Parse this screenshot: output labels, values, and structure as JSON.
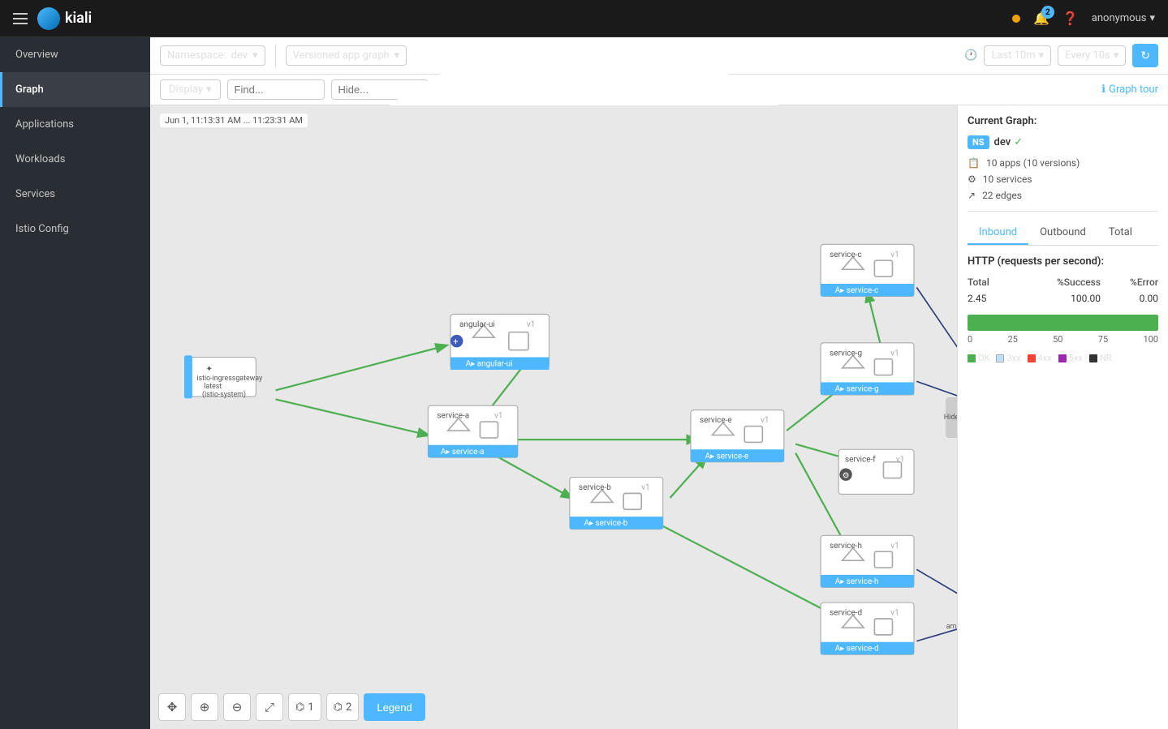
{
  "navbar": {
    "hamburger_label": "Menu",
    "brand_name": "kiali",
    "notifications_count": "2",
    "help_icon": "?",
    "user_name": "anonymous",
    "user_dot_color": "#f0a000"
  },
  "sidebar": {
    "items": [
      {
        "id": "overview",
        "label": "Overview",
        "active": false
      },
      {
        "id": "graph",
        "label": "Graph",
        "active": true
      },
      {
        "id": "applications",
        "label": "Applications",
        "active": false
      },
      {
        "id": "workloads",
        "label": "Workloads",
        "active": false
      },
      {
        "id": "services",
        "label": "Services",
        "active": false
      },
      {
        "id": "istio-config",
        "label": "Istio Config",
        "active": false
      }
    ]
  },
  "toolbar": {
    "namespace_label": "Namespace:",
    "namespace_value": "dev",
    "graph_type_label": "Versioned app graph",
    "display_label": "Display",
    "find_placeholder": "Find...",
    "hide_placeholder": "Hide...",
    "time_range_label": "Last 10m",
    "refresh_interval_label": "Every 10s",
    "graph_tour_label": "Graph tour",
    "refresh_icon": "↻"
  },
  "graph": {
    "timestamp": "Jun 1, 11:13:31 AM ... 11:23:31 AM"
  },
  "bottom_controls": {
    "btn_move": "✥",
    "btn_zoom_in": "⊕",
    "btn_zoom_out": "⊖",
    "btn_fit": "⤢",
    "btn_layout1": "⌬",
    "btn_count1": "1",
    "btn_layout2": "⌬",
    "btn_count2": "2",
    "legend_label": "Legend"
  },
  "side_panel": {
    "title": "Current Graph:",
    "namespace_badge": "NS",
    "namespace_name": "dev",
    "namespace_check": "✓",
    "stats": {
      "apps": "10 apps (10 versions)",
      "services": "10 services",
      "edges": "22 edges"
    },
    "tabs": [
      "Inbound",
      "Outbound",
      "Total"
    ],
    "active_tab": "Inbound",
    "http_title": "HTTP (requests per second):",
    "table_headers": [
      "Total",
      "%Success",
      "%Error"
    ],
    "table_values": [
      "2.45",
      "100.00",
      "0.00"
    ],
    "progress_labels": [
      "0",
      "25",
      "50",
      "75",
      "100"
    ],
    "legend": [
      {
        "label": "OK",
        "color": "#4caf50"
      },
      {
        "label": "3xx",
        "color": "#c0e0ff"
      },
      {
        "label": "4xx",
        "color": "#f44336"
      },
      {
        "label": "5xx",
        "color": "#9c27b0"
      },
      {
        "label": "NR",
        "color": "#333"
      }
    ]
  }
}
